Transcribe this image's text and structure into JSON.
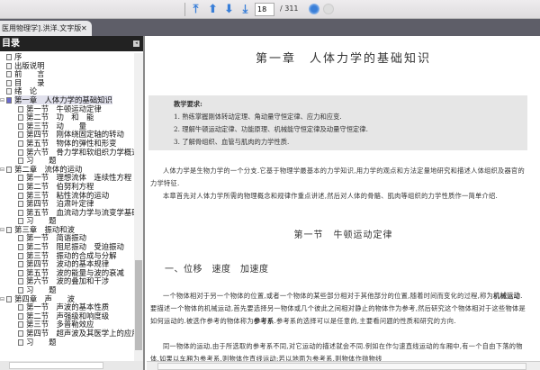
{
  "toolbar": {
    "page_current": "18",
    "page_total": "/ 311",
    "icons": [
      "first-page-icon",
      "previous-page-icon",
      "next-page-icon",
      "last-page-icon",
      "go-icon",
      "stop-icon"
    ],
    "accent": "#3a7fd8"
  },
  "tab": {
    "title": "医用物理学].洪洋.文字版",
    "close": "✕"
  },
  "sidebar": {
    "title": "目录",
    "collapse": "◂",
    "items": [
      {
        "label": "序",
        "level": 0
      },
      {
        "label": "出版说明",
        "level": 0
      },
      {
        "label": "前　　言",
        "level": 0
      },
      {
        "label": "目　　录",
        "level": 0
      },
      {
        "label": "绪　论",
        "level": 0
      },
      {
        "label": "第一章　人体力学的基础知识",
        "level": 0,
        "selected": true,
        "expanded": true
      },
      {
        "label": "第一节　牛顿运动定律",
        "level": 1
      },
      {
        "label": "第二节　功　和　能",
        "level": 1
      },
      {
        "label": "第三节　动　　量",
        "level": 1
      },
      {
        "label": "第四节　刚体绕固定轴的转动",
        "level": 1
      },
      {
        "label": "第五节　物体的弹性和形变",
        "level": 1
      },
      {
        "label": "第六节　骨力学和软组织力学概述",
        "level": 1
      },
      {
        "label": "习　　题",
        "level": 1
      },
      {
        "label": "第二章　流体的运动",
        "level": 0,
        "expanded": true
      },
      {
        "label": "第一节　理想流体　连续性方程",
        "level": 1
      },
      {
        "label": "第二节　伯努利方程",
        "level": 1
      },
      {
        "label": "第三节　粘性流体的运动",
        "level": 1
      },
      {
        "label": "第四节　泊肃叶定律",
        "level": 1
      },
      {
        "label": "第五节　血流动力学与流变学基础",
        "level": 1
      },
      {
        "label": "习　　题",
        "level": 1
      },
      {
        "label": "第三章　振动和波",
        "level": 0,
        "expanded": true
      },
      {
        "label": "第一节　简谐振动",
        "level": 1
      },
      {
        "label": "第二节　阻尼振动　受迫振动",
        "level": 1
      },
      {
        "label": "第三节　振动的合成与分解",
        "level": 1
      },
      {
        "label": "第四节　波动的基本规律",
        "level": 1
      },
      {
        "label": "第五节　波的能量与波的衰减",
        "level": 1
      },
      {
        "label": "第六节　波的叠加和干涉",
        "level": 1
      },
      {
        "label": "习　　题",
        "level": 1
      },
      {
        "label": "第四章　声　　波",
        "level": 0,
        "expanded": true
      },
      {
        "label": "第一节　声波的基本性质",
        "level": 1
      },
      {
        "label": "第二节　声强级和响度级",
        "level": 1
      },
      {
        "label": "第三节　多普勒效应",
        "level": 1
      },
      {
        "label": "第四节　超声波及其医学上的应用",
        "level": 1
      },
      {
        "label": "习　　题",
        "level": 1
      }
    ]
  },
  "doc": {
    "chapter_title": "第一章　人体力学的基础知识",
    "requirements_heading": "教学要求:",
    "requirements": [
      "1. 熟练掌握刚体转动定理、角动量守恒定律、应力和应变.",
      "2. 理解牛顿运动定律、功能原理、机械能守恒定律及动量守恒定律.",
      "3. 了解骨组织、血管与肌肉的力学性质."
    ],
    "intro1": "人体力学是生物力学的一个分支.它基于物理学最基本的力学知识,用力学的观点和方法定量地研究和描述人体组织及器官的力学特征.",
    "intro2": "本章首先对人体力学所需的物理概念和规律作重点讲述,然后对人体的骨骼、肌肉等组织的力学性质作一简单介绍.",
    "section_title": "第一节　牛顿运动定律",
    "subsection_title": "一、位移　速度　加速度",
    "p1a": "一个物体相对于另一个物体的位置,或者一个物体的某些部分相对于其他部分的位置,随着时间而变化的过程,称为",
    "p1b": "机械运动",
    "p1c": ".要描述一个物体的机械运动,首先要选择另一物体或几个彼此之间相对静止的物体作为参考,然后研究这个物体相对于这些物体是如何运动的.被选作参考的物体称为",
    "p1d": "参考系",
    "p1e": ".参考系的选择可以是任意的,主要看问题的性质和研究的方向.",
    "p2": "同一物体的运动,由于所选取的参考系不同,对它运动的描述就会不同.例如在作匀速直线运动的车厢中,有一个自由下落的物体,如果以车厢为参考系,则物体作直线运动;若以地面为参考系,则物体作抛物线"
  }
}
